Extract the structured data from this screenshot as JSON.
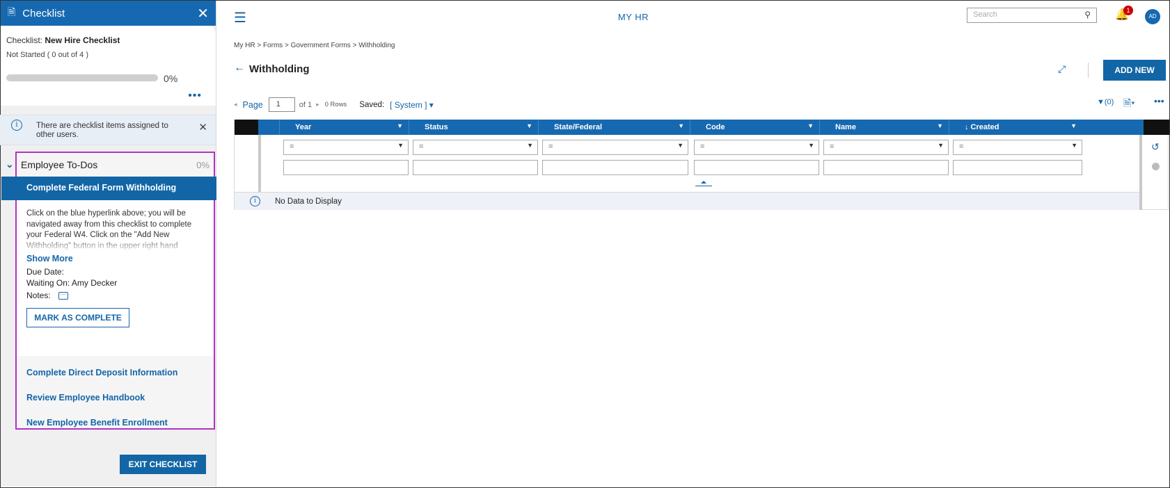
{
  "checklist": {
    "header_title": "Checklist",
    "name_label": "Checklist:",
    "name": "New Hire Checklist",
    "status": "Not Started ( 0 out of 4 )",
    "progress_fraction": 0,
    "progress_pct": "0%",
    "notice": "There are checklist items assigned to other users.",
    "section_title": "Employee To-Dos",
    "section_pct": "0%",
    "active_item": "Complete Federal Form Withholding",
    "description": "Click on the blue hyperlink above; you will be navigated away from this checklist to complete your Federal W4. Click on the \"Add New Withholding\" button in the upper right hand",
    "show_more": "Show More",
    "due_date": "Due Date:",
    "waiting_on": "Waiting On: Amy Decker",
    "notes": "Notes:",
    "mark_complete": "MARK AS COMPLETE",
    "items": [
      "Complete Direct Deposit Information",
      "Review Employee Handbook",
      "New Employee Benefit Enrollment"
    ],
    "exit": "EXIT CHECKLIST"
  },
  "topbar": {
    "app_title": "MY HR",
    "search_placeholder": "Search",
    "notification_count": "1",
    "avatar": "AD"
  },
  "page": {
    "breadcrumb": "My HR > Forms > Government Forms > Withholding",
    "title": "Withholding",
    "add_new": "ADD NEW",
    "pager_label": "Page",
    "page_value": "1",
    "page_of": "of 1",
    "rows": "0 Rows",
    "saved_label": "Saved:",
    "saved_value": "[ System ]",
    "filter_count": "(0)"
  },
  "grid": {
    "columns": [
      "Year",
      "Status",
      "State/Federal",
      "Code",
      "Name",
      "↓ Created"
    ],
    "operator": "=",
    "empty_message": "No Data to Display"
  },
  "colors": {
    "accent": "#1669b0",
    "highlight_border": "#b530c6"
  }
}
